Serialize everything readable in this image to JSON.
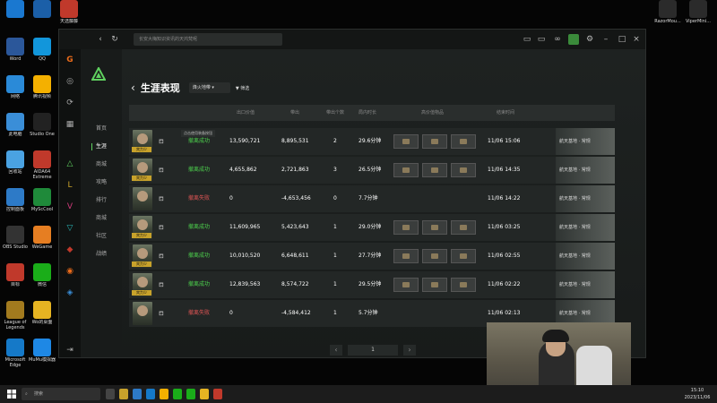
{
  "desktop": {
    "left_icons": [
      {
        "label": "",
        "color": "#1a78d0"
      },
      {
        "label": "Word",
        "color": "#2b579a"
      },
      {
        "label": "网络",
        "color": "#2a8ad8"
      },
      {
        "label": "此电脑",
        "color": "#3a8ed8"
      },
      {
        "label": "回收站",
        "color": "#4aa2e2"
      },
      {
        "label": "控制面板",
        "color": "#2d7ac7"
      },
      {
        "label": "OBS Studio",
        "color": "#333333"
      },
      {
        "label": "目标",
        "color": "#c0392b"
      },
      {
        "label": "League of Legends",
        "color": "#a27a1e"
      },
      {
        "label": "Microsoft Edge",
        "color": "#1579c8"
      }
    ],
    "col2_icons": [
      {
        "label": "",
        "color": "#1b5fa8"
      },
      {
        "label": "QQ",
        "color": "#1296db"
      },
      {
        "label": "腾讯视频",
        "color": "#f4b000"
      },
      {
        "label": "Studio One",
        "color": "#222222"
      },
      {
        "label": "AIDA64 Extreme",
        "color": "#c0392b"
      },
      {
        "label": "MyScCool",
        "color": "#1f8a3a"
      },
      {
        "label": "WeGame",
        "color": "#e67e22"
      },
      {
        "label": "微信",
        "color": "#1aad19"
      },
      {
        "label": "Wo的桌面",
        "color": "#e6b422"
      },
      {
        "label": "MuMu模拟器",
        "color": "#1e88e5"
      }
    ],
    "col3_icons": [
      {
        "label": "天选藤藤",
        "color": "#c0392b"
      },
      {
        "label": "Microsoft",
        "color": "#d63a1f"
      }
    ],
    "right_icons": [
      {
        "label": "RazorMou...",
        "color": "#2b2b2b"
      },
      {
        "label": "ViperMini...",
        "color": "#2b2b2b"
      }
    ]
  },
  "app": {
    "search_placeholder": "长安大梅知识资讯的天鸿梵呢",
    "nav": {
      "items": [
        "首页",
        "生涯",
        "商城",
        "攻略",
        "排行",
        "商城",
        "社区",
        "战绩"
      ]
    },
    "page": {
      "title": "生涯表现",
      "filter": "烽火地带",
      "filter_btn": "筛选",
      "tooltip": "点击使用装备按钮"
    },
    "table": {
      "headers": [
        "出口价值",
        "带出",
        "带出个数",
        "局内时长",
        "高价值物品",
        "结束时间"
      ]
    },
    "rows": [
      {
        "status": "撤离成功",
        "ok": true,
        "value": "13,590,721",
        "net": "8,895,531",
        "count": "2",
        "time": "29.6分钟",
        "items": 3,
        "end": "11/06 15:06",
        "badge": "宾力少"
      },
      {
        "status": "撤离成功",
        "ok": true,
        "value": "4,655,862",
        "net": "2,721,863",
        "count": "3",
        "time": "26.5分钟",
        "items": 3,
        "end": "11/06 14:35",
        "badge": "宾力少"
      },
      {
        "status": "撤离失败",
        "ok": false,
        "value": "0",
        "net": "-4,653,456",
        "count": "0",
        "time": "7.7分钟",
        "items": 0,
        "end": "11/06 14:22",
        "badge": ""
      },
      {
        "status": "撤离成功",
        "ok": true,
        "value": "11,609,965",
        "net": "5,423,643",
        "count": "1",
        "time": "29.0分钟",
        "items": 3,
        "end": "11/06 03:25",
        "badge": "宾力少"
      },
      {
        "status": "撤离成功",
        "ok": true,
        "value": "10,010,520",
        "net": "6,648,611",
        "count": "1",
        "time": "27.7分钟",
        "items": 3,
        "end": "11/06 02:55",
        "badge": "宾力少"
      },
      {
        "status": "撤离成功",
        "ok": true,
        "value": "12,839,563",
        "net": "8,574,722",
        "count": "1",
        "time": "29.5分钟",
        "items": 3,
        "end": "11/06 02:22",
        "badge": "宾力少"
      },
      {
        "status": "撤离失败",
        "ok": false,
        "value": "0",
        "net": "-4,584,412",
        "count": "1",
        "time": "5.7分钟",
        "items": 0,
        "end": "11/06 02:13",
        "badge": ""
      }
    ],
    "action_label": "航天基地 · 常规",
    "pager": {
      "page": "1",
      "prev": "‹",
      "next": "›"
    }
  },
  "taskbar": {
    "search_placeholder": "搜索",
    "time": "15:10",
    "date": "2023/11/06"
  },
  "colors": {
    "green": "#4dd14d",
    "red": "#e05555",
    "accent": "#5fd15f"
  }
}
